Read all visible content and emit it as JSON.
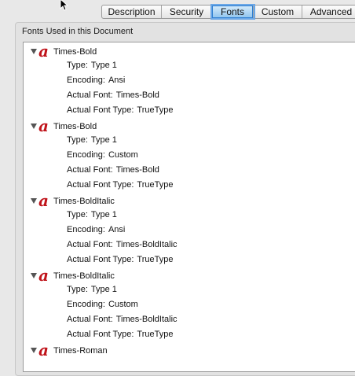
{
  "tabs": [
    "Description",
    "Security",
    "Fonts",
    "Custom",
    "Advanced"
  ],
  "active_tab": "Fonts",
  "colors": {
    "tab_active": "#8ec3ee",
    "font_icon": "#c0141b"
  },
  "group_title": "Fonts Used in this Document",
  "labels": {
    "type": "Type:",
    "encoding": "Encoding:",
    "actual_font": "Actual Font:",
    "actual_font_type": "Actual Font Type:"
  },
  "fonts": [
    {
      "name": "Times-Bold",
      "type": "Type 1",
      "encoding": "Ansi",
      "actual_font": "Times-Bold",
      "actual_font_type": "TrueType"
    },
    {
      "name": "Times-Bold",
      "type": "Type 1",
      "encoding": "Custom",
      "actual_font": "Times-Bold",
      "actual_font_type": "TrueType"
    },
    {
      "name": "Times-BoldItalic",
      "type": "Type 1",
      "encoding": "Ansi",
      "actual_font": "Times-BoldItalic",
      "actual_font_type": "TrueType"
    },
    {
      "name": "Times-BoldItalic",
      "type": "Type 1",
      "encoding": "Custom",
      "actual_font": "Times-BoldItalic",
      "actual_font_type": "TrueType"
    },
    {
      "name": "Times-Roman"
    }
  ]
}
